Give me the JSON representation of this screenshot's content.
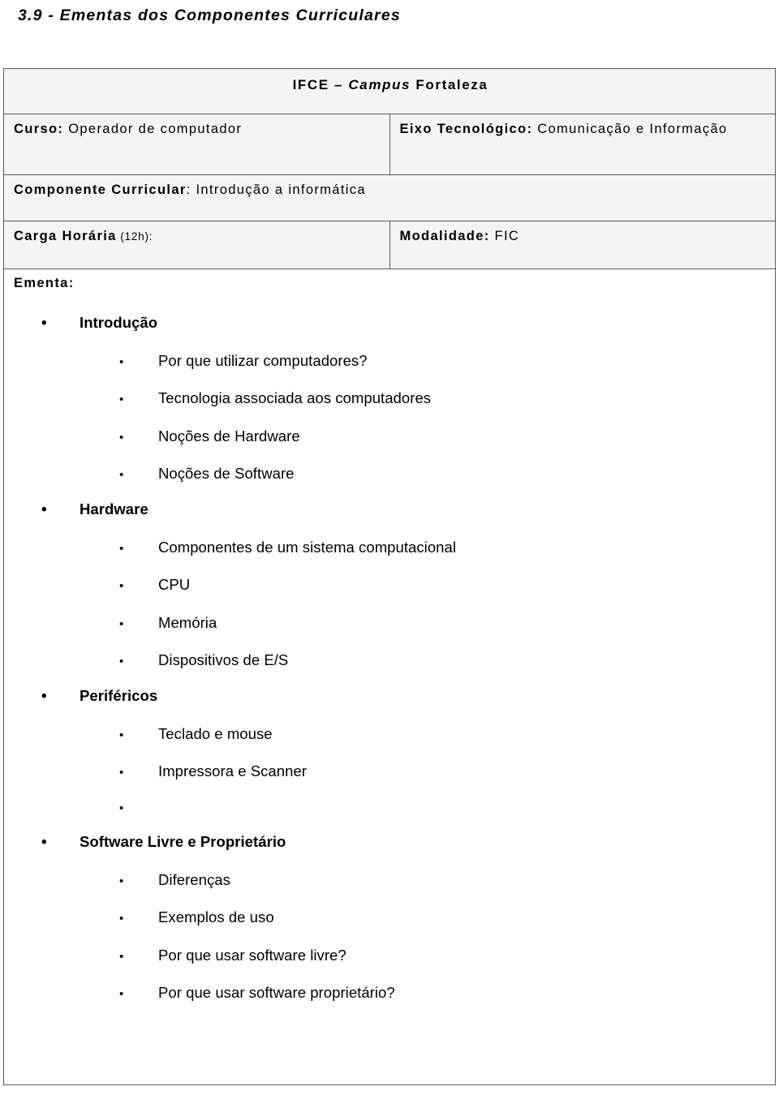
{
  "page": {
    "heading": "3.9 - Ementas dos Componentes Curriculares"
  },
  "table": {
    "institution": {
      "prefix": "IFCE – ",
      "emphasis": "Campus",
      "suffix": " Fortaleza"
    },
    "rows": [
      {
        "left_label": "Curso:",
        "left_value": " Operador de computador",
        "right_label": "Eixo Tecnológico:",
        "right_value": " Comunicação e Informação"
      },
      {
        "full_label": "Componente Curricular",
        "full_colon": ":",
        "full_value": " Introdução a informática"
      },
      {
        "left_label": "Carga Horária",
        "left_note": " (12h):",
        "right_label": "Modalidade:",
        "right_value": " FIC"
      }
    ],
    "ementa_label": "Ementa:"
  },
  "outline": {
    "bullet_level_1": "•",
    "bullet_level_2": "•",
    "items": [
      {
        "level": 1,
        "text": "Introdução"
      },
      {
        "level": 2,
        "text": "Por que utilizar computadores?"
      },
      {
        "level": 2,
        "text": "Tecnologia associada aos computadores"
      },
      {
        "level": 2,
        "text": "Noções de Hardware"
      },
      {
        "level": 2,
        "text": "Noções de Software"
      },
      {
        "level": 1,
        "text": "Hardware"
      },
      {
        "level": 2,
        "text": "Componentes de um sistema computacional"
      },
      {
        "level": 2,
        "text": "CPU"
      },
      {
        "level": 2,
        "text": "Memória"
      },
      {
        "level": 2,
        "text": "Dispositivos de E/S"
      },
      {
        "level": 1,
        "text": "Periféricos"
      },
      {
        "level": 2,
        "text": "Teclado e mouse"
      },
      {
        "level": 2,
        "text": "Impressora e Scanner"
      },
      {
        "level": 2,
        "text": ""
      },
      {
        "level": 1,
        "text": "Software Livre e Proprietário"
      },
      {
        "level": 2,
        "text": "Diferenças"
      },
      {
        "level": 2,
        "text": "Exemplos de uso"
      },
      {
        "level": 2,
        "text": "Por que usar software livre?"
      },
      {
        "level": 2,
        "text": "Por que usar software proprietário?"
      }
    ]
  },
  "colors": {
    "border": "#5a5a5a",
    "cell_background": "#f4f4f4",
    "page_background": "#ffffff",
    "text": "#000000"
  }
}
